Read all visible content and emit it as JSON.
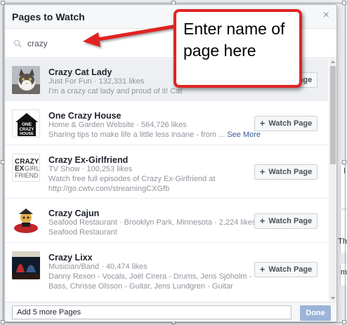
{
  "dialog": {
    "title": "Pages to Watch",
    "close_glyph": "×"
  },
  "search": {
    "value": "crazy",
    "icon": "search-icon"
  },
  "pages": [
    {
      "name": "Crazy Cat Lady",
      "meta": "Just For Fun · 132,331 likes",
      "desc": "I'm a crazy cat lady and proud of it!  Cat",
      "button_label": "Watch Page",
      "button_visible_text": "ge",
      "highlighted": true
    },
    {
      "name": "One Crazy House",
      "meta": "Home & Garden Website · 564,726 likes",
      "desc": "Sharing tips to make life a little less insane - from ...",
      "see_more": "See More",
      "button_label": "Watch Page",
      "logo_text": [
        "ONE",
        "CRAZY",
        "HOUSE"
      ]
    },
    {
      "name": "Crazy Ex-Girlfriend",
      "meta": "TV Show · 100,253 likes",
      "desc": "Watch free full episodes of Crazy Ex-Girlfriend at http://go.cwtv.com/streamingCXGfb",
      "button_label": "Watch Page",
      "logo_text": [
        "CRAZY",
        "EX",
        "GIRL",
        "FRIEND"
      ]
    },
    {
      "name": "Crazy Cajun",
      "meta": "Seafood Restaurant · Brooklyn Park, Minnesota · 2,224 likes",
      "desc": "Seafood Restaurant",
      "button_label": "Watch Page"
    },
    {
      "name": "Crazy Lixx",
      "meta": "Musician/Band · 40,474 likes",
      "desc": "Danny Rexon - Vocals, Joël Cirera - Drums, Jens Sjöholm - Bass, Chrisse Olsson - Guitar, Jens Lundgren - Guitar",
      "button_label": "Watch Page"
    }
  ],
  "footer": {
    "status": "Add 5 more Pages",
    "done_label": "Done"
  },
  "callout": {
    "text": "Enter name of page here"
  },
  "background": {
    "edge_labels": [
      "l",
      "Th",
      "m"
    ]
  },
  "colors": {
    "accent": "#4267b2",
    "done_disabled": "#9cb4d8",
    "callout_border": "#e02424",
    "link": "#365899"
  }
}
